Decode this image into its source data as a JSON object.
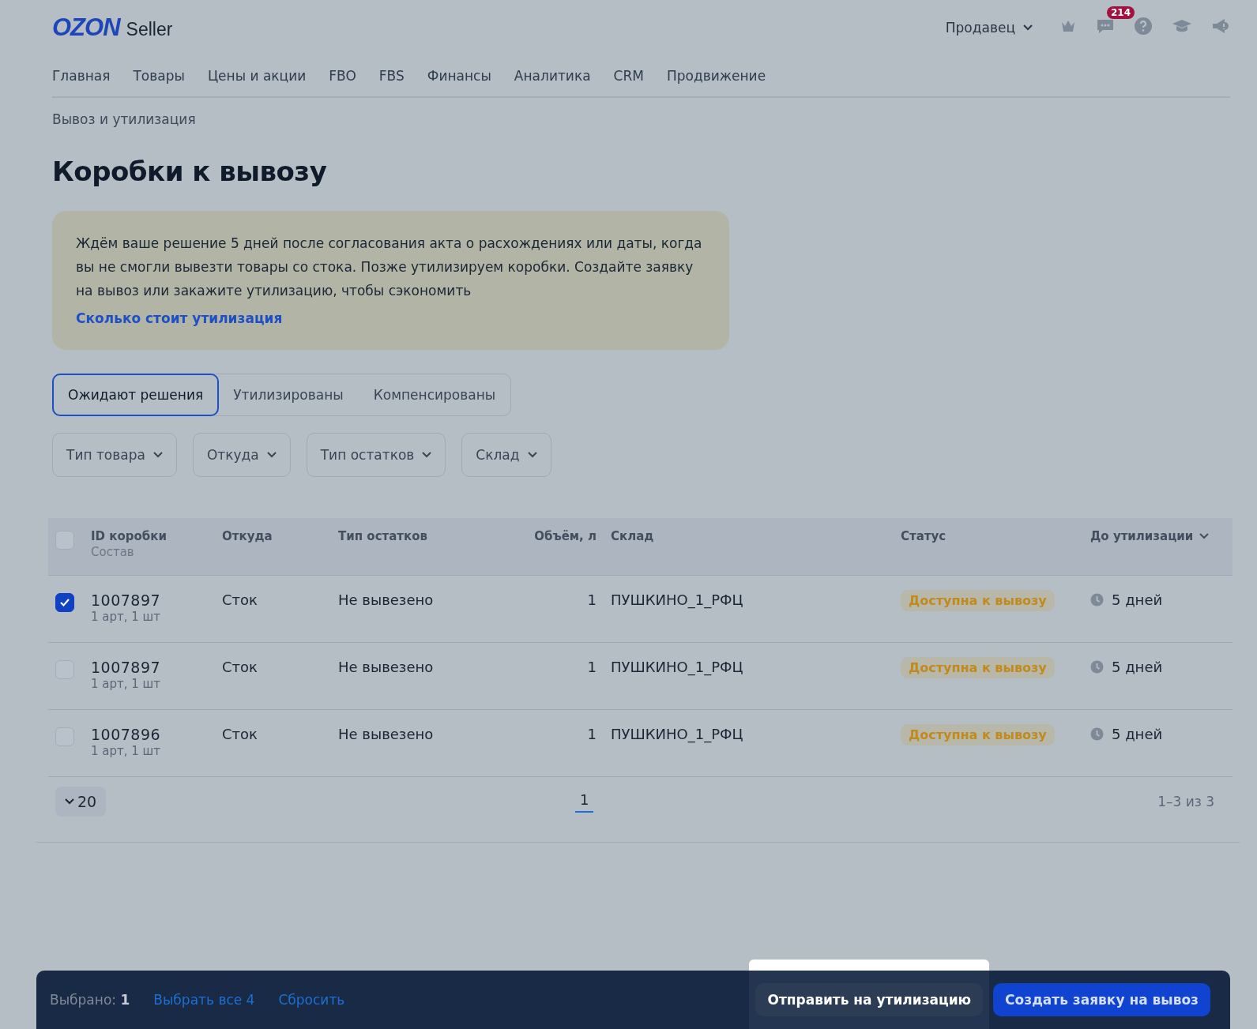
{
  "header": {
    "logo": {
      "brand": "OZON",
      "product": "Seller"
    },
    "account_menu": "Продавец",
    "messages_badge": "214"
  },
  "nav": [
    "Главная",
    "Товары",
    "Цены и акции",
    "FBO",
    "FBS",
    "Финансы",
    "Аналитика",
    "CRM",
    "Продвижение"
  ],
  "breadcrumb": "Вывоз и утилизация",
  "title": "Коробки к вывозу",
  "notice": {
    "text": "Ждём ваше решение 5 дней после согласования акта о расхождениях или даты, когда вы не смогли вывезти товары со стока. Позже утилизируем коробки. Создайте заявку на вывоз или закажите утилизацию, чтобы сэкономить",
    "link": "Сколько стоит утилизация"
  },
  "tabs": [
    {
      "label": "Ожидают решения",
      "selected": true
    },
    {
      "label": "Утилизированы",
      "selected": false
    },
    {
      "label": "Компенсированы",
      "selected": false
    }
  ],
  "filters": [
    "Тип товара",
    "Откуда",
    "Тип остатков",
    "Склад"
  ],
  "table": {
    "header_checked": false,
    "columns": [
      {
        "label": "ID коробки",
        "sublabel": "Состав"
      },
      {
        "label": "Откуда"
      },
      {
        "label": "Тип остатков"
      },
      {
        "label": "Объём, л"
      },
      {
        "label": "Склад"
      },
      {
        "label": "Статус"
      },
      {
        "label": "До утилизации",
        "sortable": true
      }
    ],
    "rows": [
      {
        "checked": true,
        "id": "1007897",
        "composition": "1 арт, 1 шт",
        "from": "Сток",
        "type": "Не вывезено",
        "volume": "1",
        "warehouse": "ПУШКИНО_1_РФЦ",
        "status": "Доступна к вывозу",
        "until": "5 дней"
      },
      {
        "checked": false,
        "id": "1007897",
        "composition": "1 арт, 1 шт",
        "from": "Сток",
        "type": "Не вывезено",
        "volume": "1",
        "warehouse": "ПУШКИНО_1_РФЦ",
        "status": "Доступна к вывозу",
        "until": "5 дней"
      },
      {
        "checked": false,
        "id": "1007896",
        "composition": "1 арт, 1 шт",
        "from": "Сток",
        "type": "Не вывезено",
        "volume": "1",
        "warehouse": "ПУШКИНО_1_РФЦ",
        "status": "Доступна к вывозу",
        "until": "5 дней"
      }
    ]
  },
  "pagination": {
    "page_size": "20",
    "pages": [
      {
        "label": "1",
        "selected": true
      }
    ],
    "range": "1–3 из 3"
  },
  "action_bar": {
    "selected_count": "Выбрано: **1**",
    "select_all": "Выбрать все 4",
    "reset": "Сбросить",
    "buttons": [
      {
        "label": "Отправить на утилизацию",
        "kind": "secondary",
        "highlighted": true
      },
      {
        "label": "Создать заявку на вывоз",
        "kind": "primary",
        "highlighted": false
      }
    ]
  }
}
